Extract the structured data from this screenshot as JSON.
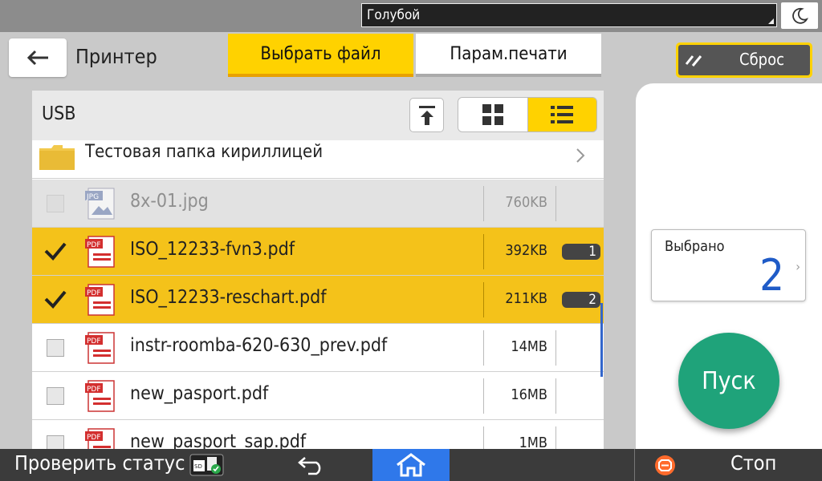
{
  "topbar": {
    "color_scheme": "Голубой"
  },
  "header": {
    "title": "Принтер"
  },
  "tabs": [
    {
      "label": "Выбрать файл"
    },
    {
      "label": "Парам.печати"
    }
  ],
  "reset_label": "Сброс",
  "browser": {
    "source": "USB",
    "folder": {
      "name": "Тестовая папка кириллицей"
    },
    "files": [
      {
        "name": "8x-01.jpg",
        "size": "760KB",
        "type": "JPG",
        "state": "disabled",
        "order": ""
      },
      {
        "name": "ISO_12233-fvn3.pdf",
        "size": "392KB",
        "type": "PDF",
        "state": "selected",
        "order": "1"
      },
      {
        "name": "ISO_12233-reschart.pdf",
        "size": "211KB",
        "type": "PDF",
        "state": "selected",
        "order": "2"
      },
      {
        "name": "instr-roomba-620-630_prev.pdf",
        "size": "14MB",
        "type": "PDF",
        "state": "normal",
        "order": ""
      },
      {
        "name": "new_pasport.pdf",
        "size": "16MB",
        "type": "PDF",
        "state": "normal",
        "order": ""
      },
      {
        "name": "new_pasport_sap.pdf",
        "size": "1MB",
        "type": "PDF",
        "state": "normal",
        "order": ""
      }
    ]
  },
  "selected": {
    "label": "Выбрано",
    "count": "2"
  },
  "start_label": "Пуск",
  "bottombar": {
    "status_label": "Проверить статус",
    "stop_label": "Стоп"
  },
  "colors": {
    "accent": "#ffd200",
    "selected_row": "#f4c21a",
    "start": "#1fa37a",
    "home": "#2f78ea",
    "count": "#1f5bc7"
  }
}
